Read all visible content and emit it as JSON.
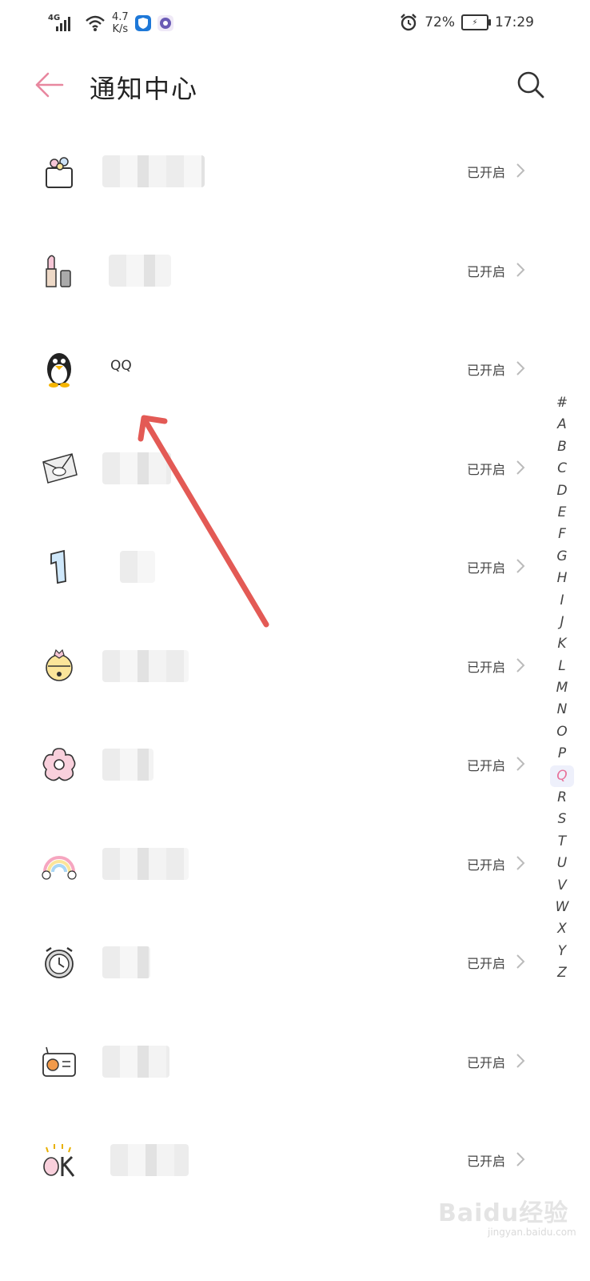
{
  "status_bar": {
    "network": "4G",
    "speed_value": "4.7",
    "speed_unit": "K/s",
    "battery": "72%",
    "time": "17:29"
  },
  "header": {
    "title": "通知中心"
  },
  "apps": [
    {
      "name": "",
      "status": "已开启",
      "icon": "gift-box-icon"
    },
    {
      "name": "",
      "status": "已开启",
      "icon": "lipstick-icon"
    },
    {
      "name": "QQ",
      "status": "已开启",
      "icon": "penguin-icon"
    },
    {
      "name": "",
      "status": "已开启",
      "icon": "qq-mail-icon"
    },
    {
      "name": "",
      "status": "已开启",
      "icon": "number-one-icon"
    },
    {
      "name": "",
      "status": "已开启",
      "icon": "bell-icon"
    },
    {
      "name": "",
      "status": "已开启",
      "icon": "flower-icon"
    },
    {
      "name": "",
      "status": "已开启",
      "icon": "rainbow-icon"
    },
    {
      "name": "",
      "status": "已开启",
      "icon": "alarm-clock-icon"
    },
    {
      "name": "",
      "status": "已开启",
      "icon": "radio-icon"
    },
    {
      "name": "",
      "status": "已开启",
      "icon": "ok-icon"
    }
  ],
  "alphabet_index": [
    "#",
    "A",
    "B",
    "C",
    "D",
    "E",
    "F",
    "G",
    "H",
    "I",
    "J",
    "K",
    "L",
    "M",
    "N",
    "O",
    "P",
    "Q",
    "R",
    "S",
    "T",
    "U",
    "V",
    "W",
    "X",
    "Y",
    "Z"
  ],
  "active_index": "Q",
  "watermark": "Baidu经验",
  "watermark_sub": "jingyan.baidu.com",
  "colors": {
    "accent": "#e8729a",
    "annotation_arrow": "#e35a55"
  }
}
